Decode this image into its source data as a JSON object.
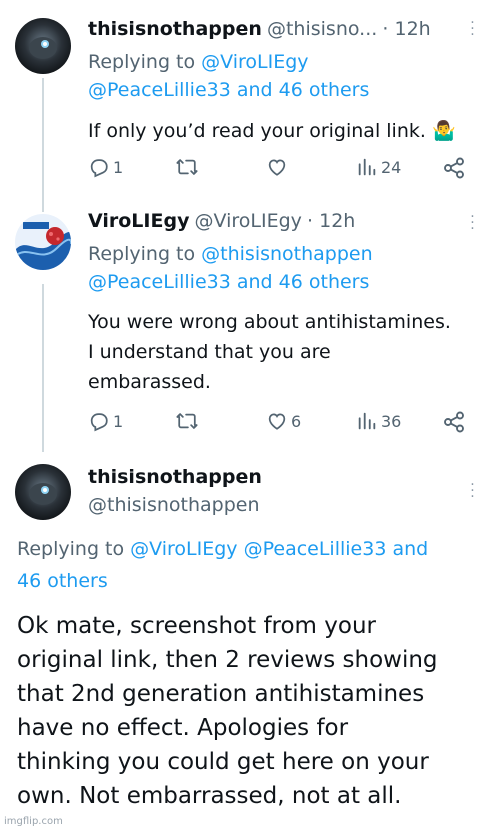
{
  "tweets": [
    {
      "name": "thisisnothappen",
      "handle": "@thisisno...",
      "time": "12h",
      "replying_prefix": "Replying to ",
      "replying_line1_mention": "@ViroLIEgy",
      "replying_line2_mention": "@PeaceLillie33",
      "replying_line2_and": " and 46 others",
      "text": "If only you’d read your original link.",
      "emoji": "🤷‍♂️",
      "replies": "1",
      "retweets": "",
      "likes": "",
      "views": "24"
    },
    {
      "name": "ViroLIEgy",
      "handle": "@ViroLIEgy",
      "time": "12h",
      "replying_prefix": "Replying to ",
      "replying_line1_mention": "@thisisnothappen",
      "replying_line2_mention": "@PeaceLillie33",
      "replying_line2_and": " and 46 others",
      "text_lines": [
        "You were wrong about antihistamines.",
        "I understand that you are",
        "embarassed."
      ],
      "replies": "1",
      "retweets": "",
      "likes": "6",
      "views": "36"
    },
    {
      "name": "thisisnothappen",
      "handle": "@thisisnothappen",
      "replying_prefix": "Replying to ",
      "replying_mention1": "@ViroLIEgy",
      "replying_mention2": "@PeaceLillie33",
      "replying_and": " and",
      "replying_line2": "46 others",
      "text_lines": [
        "Ok mate, screenshot from your",
        "original link, then 2 reviews showing",
        "that 2nd generation antihistamines",
        "have no effect. Apologies for",
        "thinking you could get here on your",
        "own. Not embarrassed, not at all."
      ]
    }
  ],
  "watermark": "imgflip.com",
  "icons": {
    "reply": "reply-icon",
    "retweet": "retweet-icon",
    "like": "heart-icon",
    "views": "views-icon",
    "share": "share-icon",
    "more": "more-icon"
  },
  "colors": {
    "link": "#1d9bf0",
    "muted": "#536471",
    "text": "#0f1419",
    "line": "#cfd9de"
  }
}
